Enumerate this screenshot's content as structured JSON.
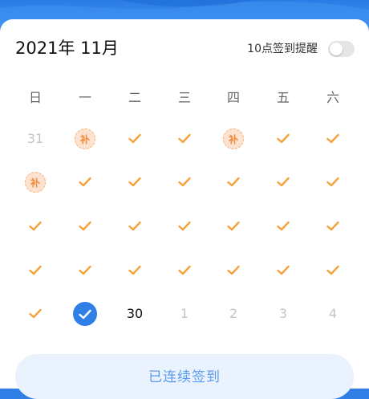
{
  "header": {
    "month_label": "2021年 11月",
    "reminder_label": "10点签到提醒",
    "reminder_enabled": false
  },
  "weekdays": [
    "日",
    "一",
    "二",
    "三",
    "四",
    "五",
    "六"
  ],
  "calendar": {
    "weeks": [
      [
        {
          "type": "num",
          "text": "31",
          "state": "dim"
        },
        {
          "type": "makeup",
          "text": "补"
        },
        {
          "type": "check"
        },
        {
          "type": "check"
        },
        {
          "type": "makeup",
          "text": "补"
        },
        {
          "type": "check"
        },
        {
          "type": "check"
        }
      ],
      [
        {
          "type": "makeup",
          "text": "补"
        },
        {
          "type": "check"
        },
        {
          "type": "check"
        },
        {
          "type": "check"
        },
        {
          "type": "check"
        },
        {
          "type": "check"
        },
        {
          "type": "check"
        }
      ],
      [
        {
          "type": "check"
        },
        {
          "type": "check"
        },
        {
          "type": "check"
        },
        {
          "type": "check"
        },
        {
          "type": "check"
        },
        {
          "type": "check"
        },
        {
          "type": "check"
        }
      ],
      [
        {
          "type": "check"
        },
        {
          "type": "check"
        },
        {
          "type": "check"
        },
        {
          "type": "check"
        },
        {
          "type": "check"
        },
        {
          "type": "check"
        },
        {
          "type": "check"
        }
      ],
      [
        {
          "type": "check"
        },
        {
          "type": "today"
        },
        {
          "type": "num",
          "text": "30",
          "state": "dark"
        },
        {
          "type": "num",
          "text": "1",
          "state": "dim"
        },
        {
          "type": "num",
          "text": "2",
          "state": "dim"
        },
        {
          "type": "num",
          "text": "3",
          "state": "dim"
        },
        {
          "type": "num",
          "text": "4",
          "state": "dim"
        }
      ]
    ]
  },
  "colors": {
    "accent_blue": "#2f7fe6",
    "check_orange": "#f5a23a",
    "makeup_fill": "#fde3cf",
    "makeup_text": "#f08a3c"
  },
  "bottom_button": {
    "label": "已连续签到"
  }
}
